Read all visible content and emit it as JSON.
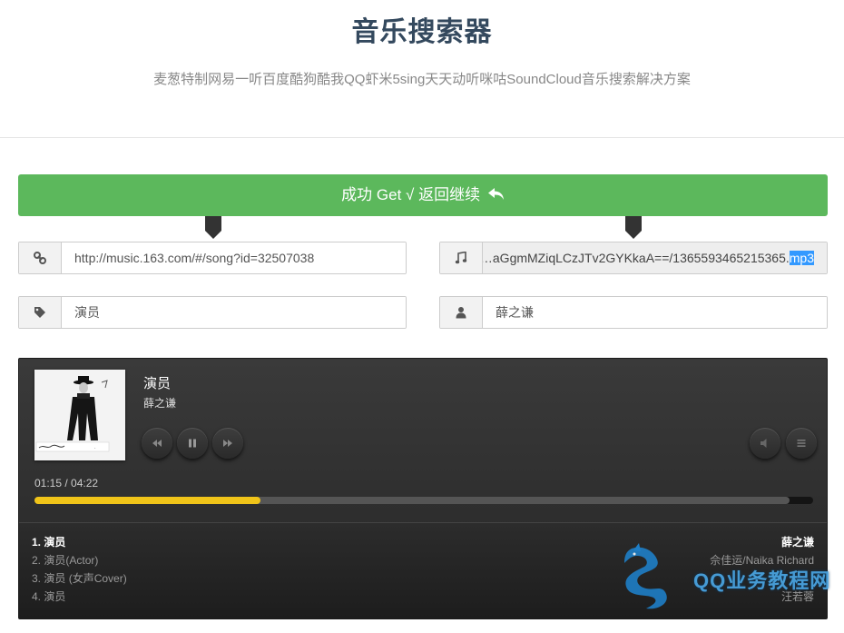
{
  "header": {
    "title": "音乐搜索器",
    "subtitle": "麦葱特制网易一听百度酷狗酷我QQ虾米5sing天天动听咪咕SoundCloud音乐搜索解决方案"
  },
  "status": {
    "label": "成功 Get √ 返回继续",
    "icon": "reply-icon",
    "color": "#5cb85c"
  },
  "fields": {
    "link": {
      "icon": "link-icon",
      "value": "http://music.163.com/#/song?id=32507038"
    },
    "file": {
      "icon": "music-icon",
      "value_prefix": "…aGgmMZiqLCzJTv2GYKkaA==/1365593465215365.",
      "value_selected": "mp3"
    },
    "title": {
      "icon": "tag-icon",
      "value": "演员"
    },
    "author": {
      "icon": "user-icon",
      "value": "薛之谦"
    }
  },
  "player": {
    "title": "演员",
    "artist": "薛之谦",
    "time": "01:15 / 04:22",
    "progress": 0.29,
    "buffered": 0.97,
    "accent": "#f0c419",
    "playlist": [
      {
        "num": "1.",
        "title": "演员",
        "artist": "薛之谦",
        "active": true
      },
      {
        "num": "2.",
        "title": "演员(Actor)",
        "artist": "佘佳运/Naika Richard",
        "active": false
      },
      {
        "num": "3.",
        "title": "演员 (女声Cover)",
        "artist": "",
        "active": false
      },
      {
        "num": "4.",
        "title": "演员",
        "artist": "汪若蓉",
        "active": false
      }
    ]
  },
  "watermark": {
    "text": "QQ业务教程网"
  }
}
